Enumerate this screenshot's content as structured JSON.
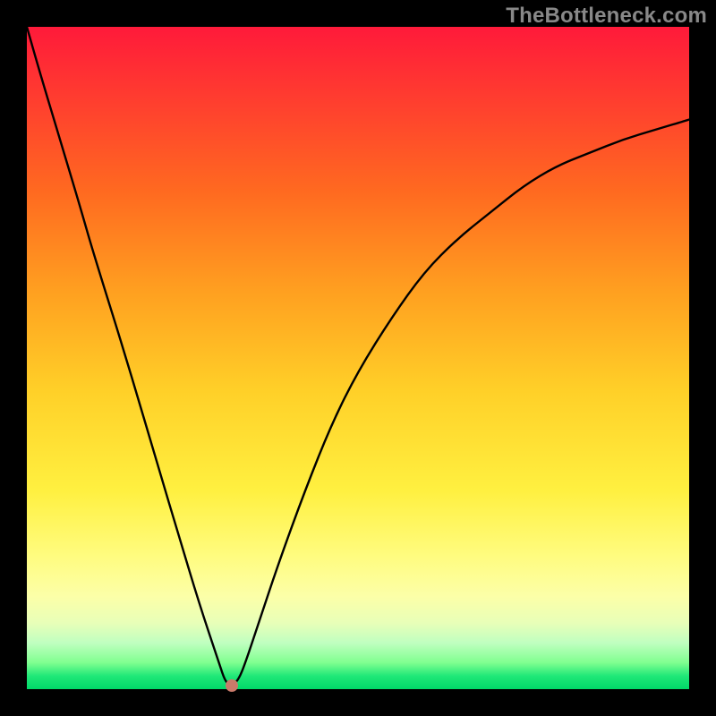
{
  "watermark": "TheBottleneck.com",
  "chart_data": {
    "type": "line",
    "title": "",
    "xlabel": "",
    "ylabel": "",
    "xlim": [
      0,
      100
    ],
    "ylim": [
      0,
      100
    ],
    "series": [
      {
        "name": "curve",
        "x": [
          0,
          2,
          5,
          8,
          10,
          15,
          20,
          23,
          26,
          29,
          30,
          31,
          32,
          33,
          35,
          38,
          42,
          46,
          50,
          55,
          60,
          65,
          70,
          75,
          80,
          85,
          90,
          95,
          100
        ],
        "y": [
          100,
          93,
          83,
          73,
          66,
          50,
          33,
          23,
          13,
          4,
          1,
          0.5,
          1.5,
          4,
          10,
          19,
          30,
          40,
          48,
          56,
          63,
          68,
          72,
          76,
          79,
          81,
          83,
          84.5,
          86
        ]
      }
    ],
    "annotations": {
      "marker": {
        "x": 31,
        "y": 0.5,
        "color": "#c97a6a"
      }
    },
    "grid": false,
    "colors": {
      "background_gradient": [
        "#ff1a3a",
        "#00d868"
      ],
      "curve": "#000000",
      "marker": "#c97a6a"
    }
  }
}
